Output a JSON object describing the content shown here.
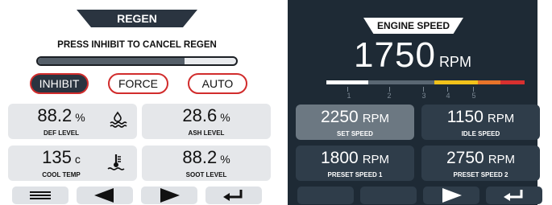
{
  "regen": {
    "title": "REGEN",
    "message": "PRESS INHIBIT TO CANCEL REGEN",
    "progress_fraction": 0.74,
    "modes": [
      {
        "label": "INHIBIT",
        "active": true
      },
      {
        "label": "FORCE",
        "active": false
      },
      {
        "label": "AUTO",
        "active": false
      }
    ],
    "gauges": [
      {
        "value": "88.2",
        "unit": "%",
        "label": "DEF LEVEL",
        "icon": "def-fluid-icon"
      },
      {
        "value": "28.6",
        "unit": "%",
        "label": "ASH LEVEL",
        "icon": ""
      },
      {
        "value": "135",
        "unit": "c",
        "label": "COOL TEMP",
        "icon": "coolant-temp-icon"
      },
      {
        "value": "88.2",
        "unit": "%",
        "label": "SOOT LEVEL",
        "icon": ""
      }
    ],
    "nav": [
      "menu-icon",
      "left-arrow-icon",
      "right-arrow-icon",
      "enter-icon"
    ]
  },
  "engine": {
    "title": "ENGINE SPEED",
    "rpm_value": "1750",
    "rpm_unit": "RPM",
    "gauge_ticks": [
      "1",
      "2",
      "3",
      "4",
      "5"
    ],
    "gauge_level_fraction": 0.21,
    "colors": {
      "normal": "#5a6773",
      "caution": "#f2c21b",
      "warn": "#e8742a",
      "danger": "#d8302f",
      "fill": "#ffffff"
    },
    "speeds": [
      {
        "value": "2250",
        "unit": "RPM",
        "label": "SET SPEED",
        "selected": true
      },
      {
        "value": "1150",
        "unit": "RPM",
        "label": "IDLE SPEED",
        "selected": false
      },
      {
        "value": "1800",
        "unit": "RPM",
        "label": "PRESET SPEED 1",
        "selected": false
      },
      {
        "value": "2750",
        "unit": "RPM",
        "label": "PRESET SPEED 2",
        "selected": false
      }
    ],
    "nav": [
      "",
      "",
      "right-arrow-icon",
      "enter-icon"
    ]
  }
}
